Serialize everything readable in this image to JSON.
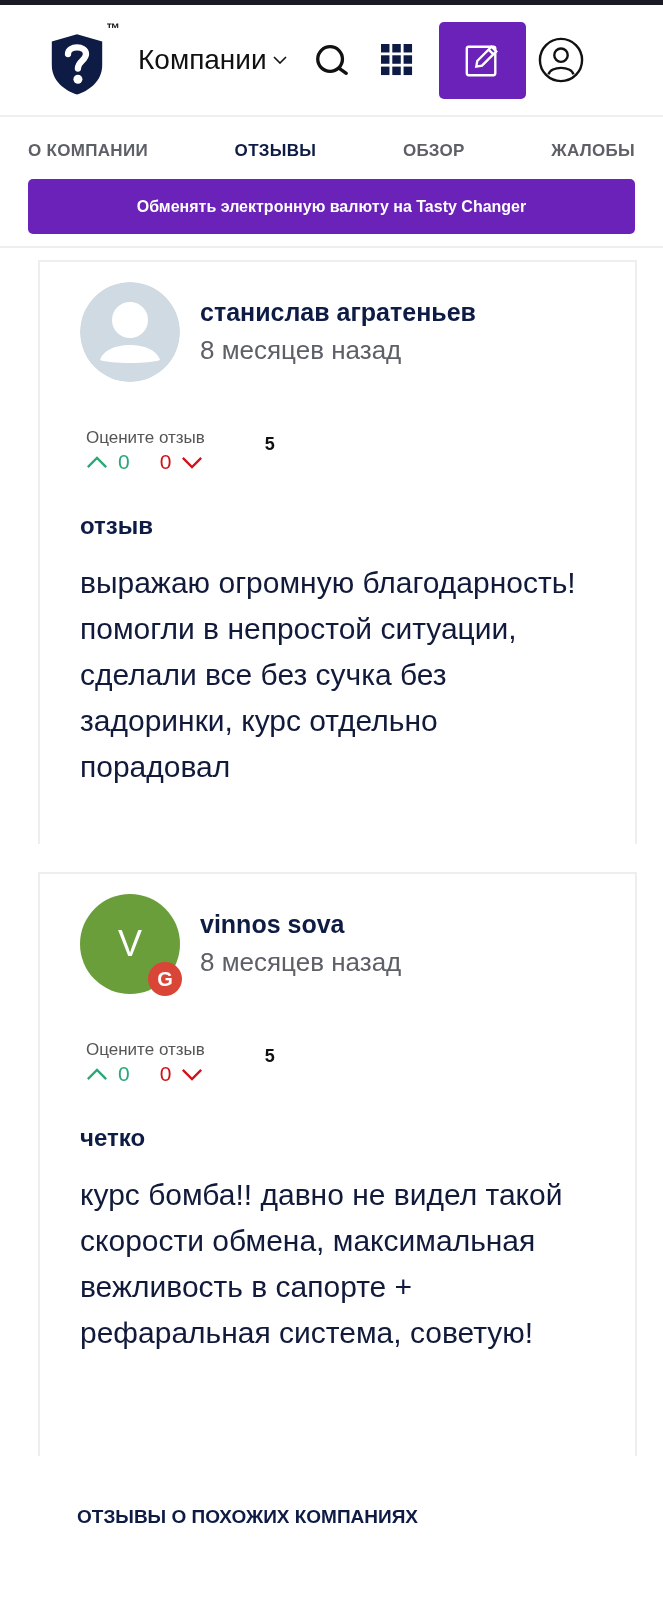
{
  "header": {
    "trademark": "™",
    "menu_label": "Компании"
  },
  "tabs": [
    {
      "label": "О КОМПАНИИ",
      "selected": false
    },
    {
      "label": "ОТЗЫВЫ",
      "selected": true
    },
    {
      "label": "ОБЗОР",
      "selected": false
    },
    {
      "label": "ЖАЛОБЫ",
      "selected": false
    }
  ],
  "banner": "Обменять электронную валюту на Tasty Changer",
  "reviews": [
    {
      "author": "станислав агратеньев",
      "time": "8 месяцев назад",
      "avatar": {
        "kind": "placeholder",
        "color": "#d0dae3"
      },
      "rate_label": "Оцените отзыв",
      "upvotes": "0",
      "downvotes": "0",
      "score": "5",
      "title": "отзыв",
      "text": "выражаю огромную благодарность! помогли в непростой ситуации, сделали все без сучка без задоринки, курс отдельно порадовал"
    },
    {
      "author": "vinnos sova",
      "time": "8 месяцев назад",
      "avatar": {
        "kind": "initial",
        "letter": "V",
        "color": "#6a9e3a",
        "badge": "G"
      },
      "rate_label": "Оцените отзыв",
      "upvotes": "0",
      "downvotes": "0",
      "score": "5",
      "title": "четко",
      "text": "курс бомба!! давно не видел такой скорости обмена, максимальная вежливость в сапорте + рефаральная система, советую!"
    }
  ],
  "section_heading": "ОТЗЫВЫ О ПОХОЖИХ КОМПАНИЯХ"
}
